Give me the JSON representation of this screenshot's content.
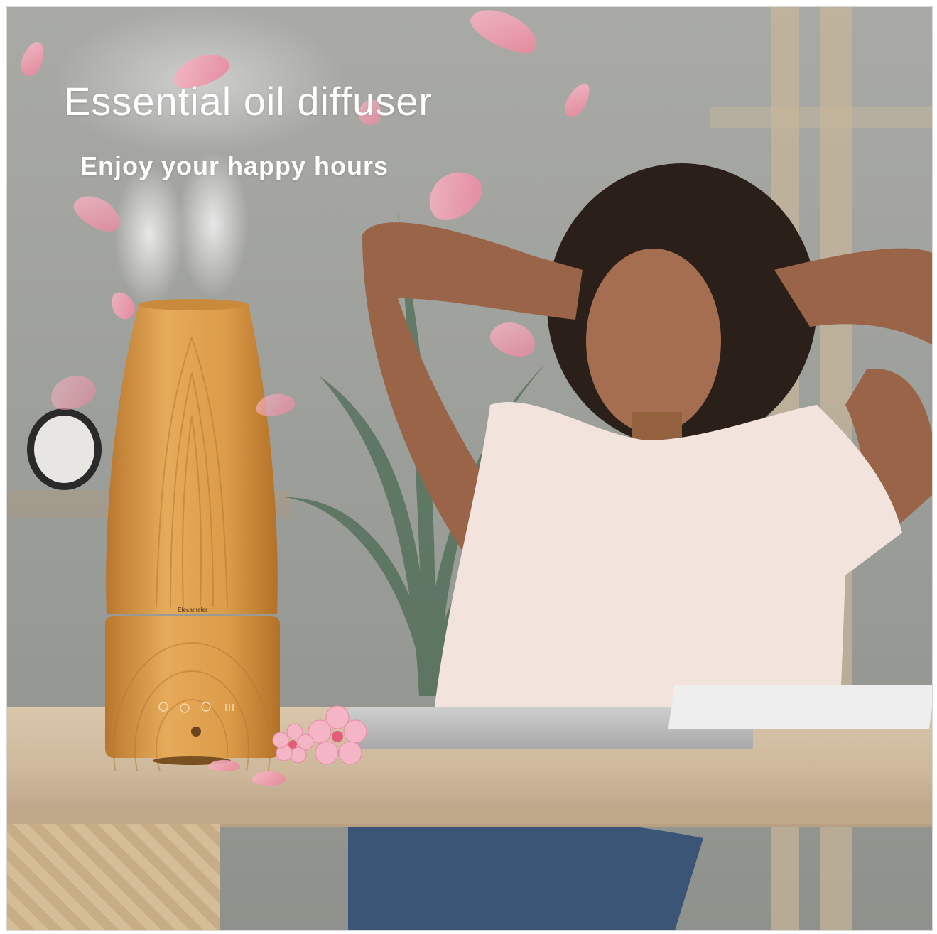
{
  "headline": "Essential oil diffuser",
  "subheadline": "Enjoy your happy hours",
  "product_brand": "Elecameler",
  "colors": {
    "wood": "#d99a45",
    "petal": "#f2a7b8",
    "text": "#ffffff",
    "wall": "#a3a49f"
  }
}
